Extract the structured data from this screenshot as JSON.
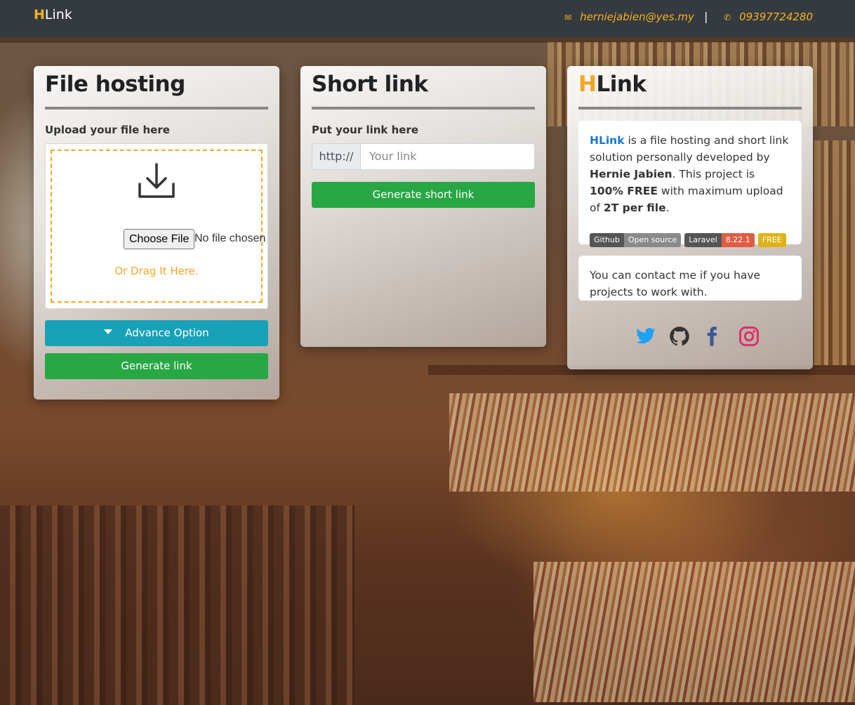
{
  "header": {
    "brand_h": "H",
    "brand_rest": "Link",
    "email": "herniejabien@yes.my",
    "separator": "|",
    "phone": "09397724280"
  },
  "file_hosting": {
    "title": "File hosting",
    "upload_label": "Upload your file here",
    "choose_file_label": "Choose File",
    "no_file_text": "No file chosen",
    "drag_text": "Or Drag It Here.",
    "advance_option_label": "Advance Option",
    "generate_link_label": "Generate link"
  },
  "short_link": {
    "title": "Short link",
    "put_link_label": "Put your link here",
    "prefix": "http://",
    "input_placeholder": "Your link",
    "generate_label": "Generate short link"
  },
  "about": {
    "title_h": "H",
    "title_rest": "Link",
    "desc_brand": "HLink",
    "desc_1": " is a file hosting and short link solution personally developed by ",
    "desc_author": "Hernie Jabien",
    "desc_2": ". This project is ",
    "desc_free": "100% FREE",
    "desc_3": " with maximum upload of ",
    "desc_size": "2T per file",
    "desc_4": ".",
    "badges": [
      {
        "left": "Github",
        "right": "Open source"
      },
      {
        "left": "Laravel",
        "right": "8.22.1"
      },
      {
        "left": "FREE"
      }
    ],
    "contact_text": "You can contact me if you have projects to work with.",
    "socials": [
      "twitter-icon",
      "github-icon",
      "facebook-icon",
      "instagram-icon"
    ]
  },
  "colors": {
    "accent": "#f5a623",
    "topbar": "#343a40",
    "info_button": "#17a2b8",
    "success_button": "#28a745",
    "twitter": "#1da1f2",
    "facebook": "#3b5998",
    "instagram": "#e1306c"
  }
}
